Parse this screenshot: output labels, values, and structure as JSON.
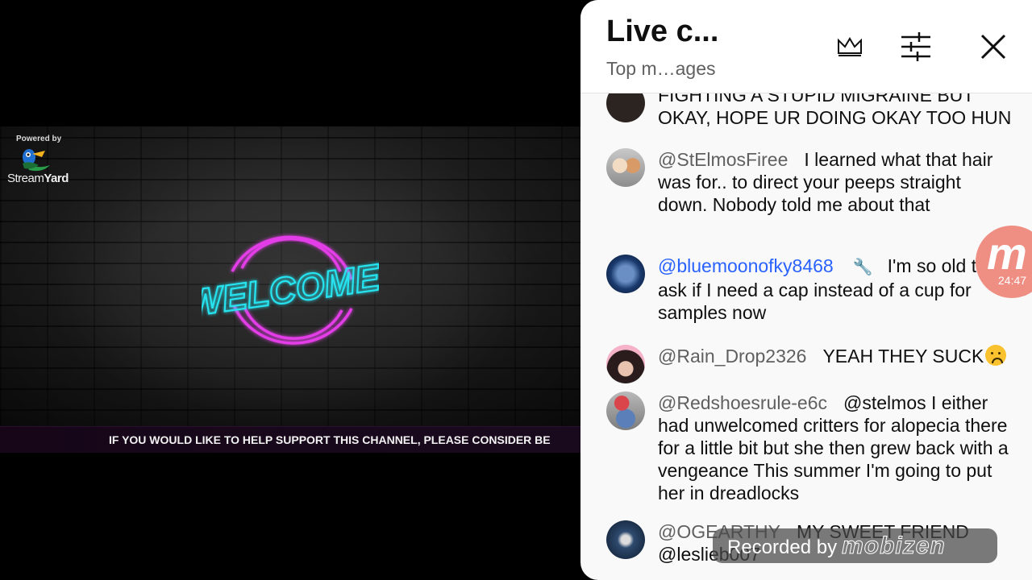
{
  "video": {
    "powered_by": "Powered by",
    "streamyard_name_light": "Stream",
    "streamyard_name_bold": "Yard",
    "welcome_sign": "WELCOME!",
    "ticker_text": "IF YOU WOULD LIKE TO HELP SUPPORT THIS CHANNEL, PLEASE CONSIDER BE",
    "colors": {
      "neon_pink": "#e23ee6",
      "neon_cyan": "#27e3f0"
    }
  },
  "chat": {
    "title": "Live c...",
    "subtitle": "Top m…ages",
    "icons": {
      "crown": "crown-icon",
      "filter": "filter-sliders-icon",
      "close": "close-icon"
    },
    "messages": [
      {
        "author": "",
        "text": "FIGHTING A STUPID MIGRAINE BUT OKAY, HOPE UR DOING OKAY TOO HUN"
      },
      {
        "author": "@StElmosFiree",
        "text": "I learned what that hair was for.. to direct your peeps straight down. Nobody told me about that"
      },
      {
        "author": "@bluemoonofky8468",
        "moderator": true,
        "text": "I'm so old they ask if I need a cap instead of a cup for samples now"
      },
      {
        "author": "@Rain_Drop2326",
        "text": "YEAH THEY SUCK"
      },
      {
        "author": "@Redshoesrule-e6c",
        "text": "@stelmos I either had unwelcomed critters for alopecia there for a little bit but she then grew back with a vengeance This summer I'm going to put her in dreadlocks"
      },
      {
        "author": "@OGEARTHY",
        "text": "MY SWEET FRIEND @leslieb007"
      }
    ]
  },
  "overlay": {
    "recorder_letter": "m",
    "recorder_timer": "24:47",
    "recorded_by_label": "Recorded by",
    "recorded_by_brand": "mobizen"
  }
}
